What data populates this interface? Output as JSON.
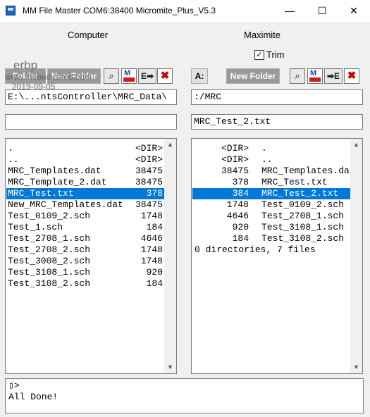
{
  "window": {
    "title": "MM File Master  COM6:38400  Micromite_Plus_V5.3",
    "minimize": "—",
    "maximize": "☐",
    "close": "✕"
  },
  "sections": {
    "computer": "Computer",
    "maximite": "Maximite"
  },
  "trim": {
    "label": "Trim",
    "checked": true,
    "mark": "✓"
  },
  "left_toolbar": {
    "folder": "Folder",
    "new_folder": "New Folder",
    "search_glyph": "⌕",
    "mm_glyph": "M",
    "send_glyph": "E➡",
    "delete_glyph": "✖"
  },
  "right_toolbar": {
    "drive": "A:",
    "new_folder": "New Folder",
    "search_glyph": "⌕",
    "mm_glyph": "M",
    "send_glyph": "➡E",
    "delete_glyph": "✖"
  },
  "left_path": "E:\\...ntsController\\MRC_Data\\",
  "left_filename": "",
  "right_path": ":/MRC",
  "right_filename": "MRC_Test_2.txt",
  "left_files": [
    {
      "name": ".",
      "size": "<DIR>"
    },
    {
      "name": "..",
      "size": "<DIR>"
    },
    {
      "name": "MRC_Templates.dat",
      "size": "38475"
    },
    {
      "name": "MRC_Template_2.dat",
      "size": "38475"
    },
    {
      "name": "MRC_Test.txt",
      "size": "378"
    },
    {
      "name": "New_MRC_Templates.dat",
      "size": "38475"
    },
    {
      "name": "Test_0109_2.sch",
      "size": "1748"
    },
    {
      "name": "Test_1.sch",
      "size": "184"
    },
    {
      "name": "Test_2708_1.sch",
      "size": "4646"
    },
    {
      "name": "Test_2708_2.sch",
      "size": "1748"
    },
    {
      "name": "Test_3008_2.sch",
      "size": "1748"
    },
    {
      "name": "Test_3108_1.sch",
      "size": "920"
    },
    {
      "name": "Test_3108_2.sch",
      "size": "184"
    }
  ],
  "left_selected": 4,
  "right_files": [
    {
      "size": "<DIR>",
      "name": "."
    },
    {
      "size": "<DIR>",
      "name": ".."
    },
    {
      "size": "38475",
      "name": "MRC_Templates.dat"
    },
    {
      "size": "378",
      "name": "MRC_Test.txt"
    },
    {
      "size": "384",
      "name": "MRC_Test_2.txt"
    },
    {
      "size": "1748",
      "name": "Test_0109_2.sch"
    },
    {
      "size": "4646",
      "name": "Test_2708_1.sch"
    },
    {
      "size": "920",
      "name": "Test_3108_1.sch"
    },
    {
      "size": "184",
      "name": "Test_3108_2.sch"
    }
  ],
  "right_selected": 4,
  "right_summary": "0 directories, 7 files",
  "scroll_up": "▲",
  "scroll_down": "▼",
  "console": {
    "prompt": "▯>",
    "message": "All Done!"
  },
  "watermark": {
    "line1": "erbp",
    "line2": "www.thebackshed.com",
    "line3": "2019-09-05"
  },
  "colors": {
    "selection": "#0078d7",
    "delete_red": "#cc0000",
    "mm_blue": "#1846c8"
  }
}
